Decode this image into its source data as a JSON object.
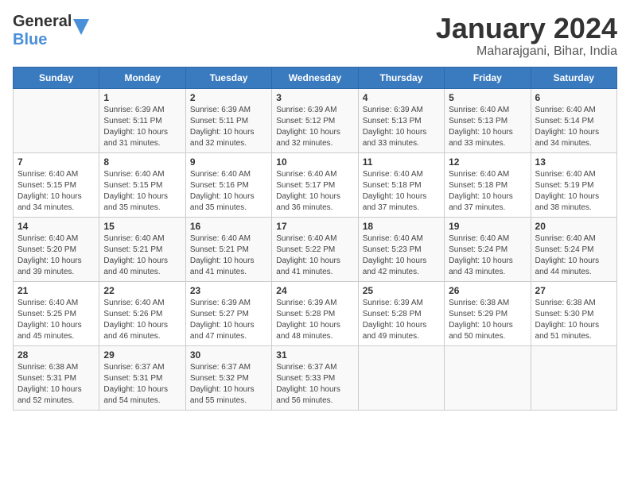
{
  "header": {
    "logo_general": "General",
    "logo_blue": "Blue",
    "month_title": "January 2024",
    "location": "Maharajgani, Bihar, India"
  },
  "days_of_week": [
    "Sunday",
    "Monday",
    "Tuesday",
    "Wednesday",
    "Thursday",
    "Friday",
    "Saturday"
  ],
  "weeks": [
    [
      {
        "day": "",
        "info": ""
      },
      {
        "day": "1",
        "info": "Sunrise: 6:39 AM\nSunset: 5:11 PM\nDaylight: 10 hours and 31 minutes."
      },
      {
        "day": "2",
        "info": "Sunrise: 6:39 AM\nSunset: 5:11 PM\nDaylight: 10 hours and 32 minutes."
      },
      {
        "day": "3",
        "info": "Sunrise: 6:39 AM\nSunset: 5:12 PM\nDaylight: 10 hours and 32 minutes."
      },
      {
        "day": "4",
        "info": "Sunrise: 6:39 AM\nSunset: 5:13 PM\nDaylight: 10 hours and 33 minutes."
      },
      {
        "day": "5",
        "info": "Sunrise: 6:40 AM\nSunset: 5:13 PM\nDaylight: 10 hours and 33 minutes."
      },
      {
        "day": "6",
        "info": "Sunrise: 6:40 AM\nSunset: 5:14 PM\nDaylight: 10 hours and 34 minutes."
      }
    ],
    [
      {
        "day": "7",
        "info": "Sunrise: 6:40 AM\nSunset: 5:15 PM\nDaylight: 10 hours and 34 minutes."
      },
      {
        "day": "8",
        "info": "Sunrise: 6:40 AM\nSunset: 5:15 PM\nDaylight: 10 hours and 35 minutes."
      },
      {
        "day": "9",
        "info": "Sunrise: 6:40 AM\nSunset: 5:16 PM\nDaylight: 10 hours and 35 minutes."
      },
      {
        "day": "10",
        "info": "Sunrise: 6:40 AM\nSunset: 5:17 PM\nDaylight: 10 hours and 36 minutes."
      },
      {
        "day": "11",
        "info": "Sunrise: 6:40 AM\nSunset: 5:18 PM\nDaylight: 10 hours and 37 minutes."
      },
      {
        "day": "12",
        "info": "Sunrise: 6:40 AM\nSunset: 5:18 PM\nDaylight: 10 hours and 37 minutes."
      },
      {
        "day": "13",
        "info": "Sunrise: 6:40 AM\nSunset: 5:19 PM\nDaylight: 10 hours and 38 minutes."
      }
    ],
    [
      {
        "day": "14",
        "info": "Sunrise: 6:40 AM\nSunset: 5:20 PM\nDaylight: 10 hours and 39 minutes."
      },
      {
        "day": "15",
        "info": "Sunrise: 6:40 AM\nSunset: 5:21 PM\nDaylight: 10 hours and 40 minutes."
      },
      {
        "day": "16",
        "info": "Sunrise: 6:40 AM\nSunset: 5:21 PM\nDaylight: 10 hours and 41 minutes."
      },
      {
        "day": "17",
        "info": "Sunrise: 6:40 AM\nSunset: 5:22 PM\nDaylight: 10 hours and 41 minutes."
      },
      {
        "day": "18",
        "info": "Sunrise: 6:40 AM\nSunset: 5:23 PM\nDaylight: 10 hours and 42 minutes."
      },
      {
        "day": "19",
        "info": "Sunrise: 6:40 AM\nSunset: 5:24 PM\nDaylight: 10 hours and 43 minutes."
      },
      {
        "day": "20",
        "info": "Sunrise: 6:40 AM\nSunset: 5:24 PM\nDaylight: 10 hours and 44 minutes."
      }
    ],
    [
      {
        "day": "21",
        "info": "Sunrise: 6:40 AM\nSunset: 5:25 PM\nDaylight: 10 hours and 45 minutes."
      },
      {
        "day": "22",
        "info": "Sunrise: 6:40 AM\nSunset: 5:26 PM\nDaylight: 10 hours and 46 minutes."
      },
      {
        "day": "23",
        "info": "Sunrise: 6:39 AM\nSunset: 5:27 PM\nDaylight: 10 hours and 47 minutes."
      },
      {
        "day": "24",
        "info": "Sunrise: 6:39 AM\nSunset: 5:28 PM\nDaylight: 10 hours and 48 minutes."
      },
      {
        "day": "25",
        "info": "Sunrise: 6:39 AM\nSunset: 5:28 PM\nDaylight: 10 hours and 49 minutes."
      },
      {
        "day": "26",
        "info": "Sunrise: 6:38 AM\nSunset: 5:29 PM\nDaylight: 10 hours and 50 minutes."
      },
      {
        "day": "27",
        "info": "Sunrise: 6:38 AM\nSunset: 5:30 PM\nDaylight: 10 hours and 51 minutes."
      }
    ],
    [
      {
        "day": "28",
        "info": "Sunrise: 6:38 AM\nSunset: 5:31 PM\nDaylight: 10 hours and 52 minutes."
      },
      {
        "day": "29",
        "info": "Sunrise: 6:37 AM\nSunset: 5:31 PM\nDaylight: 10 hours and 54 minutes."
      },
      {
        "day": "30",
        "info": "Sunrise: 6:37 AM\nSunset: 5:32 PM\nDaylight: 10 hours and 55 minutes."
      },
      {
        "day": "31",
        "info": "Sunrise: 6:37 AM\nSunset: 5:33 PM\nDaylight: 10 hours and 56 minutes."
      },
      {
        "day": "",
        "info": ""
      },
      {
        "day": "",
        "info": ""
      },
      {
        "day": "",
        "info": ""
      }
    ]
  ]
}
